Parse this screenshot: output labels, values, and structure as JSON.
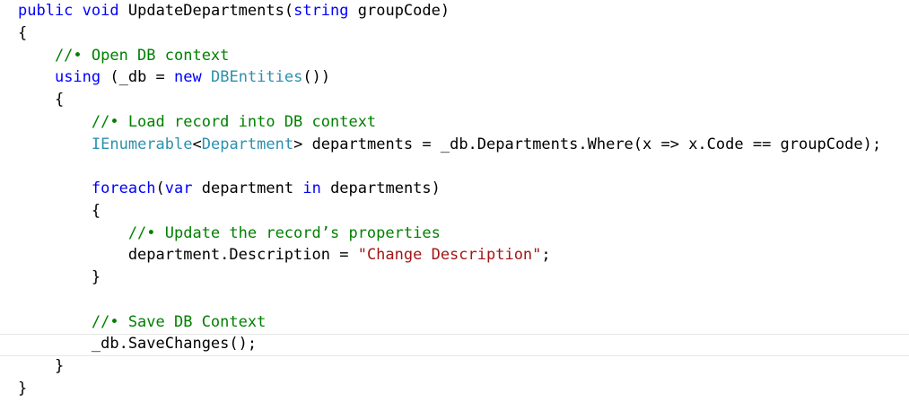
{
  "editor": {
    "colors": {
      "keyword": "#0000ff",
      "type": "#2b91af",
      "comment": "#008000",
      "string": "#a31515",
      "plain": "#000000",
      "background": "#ffffff"
    },
    "lines": [
      [
        {
          "t": "kw",
          "v": "public"
        },
        {
          "t": "pl",
          "v": " "
        },
        {
          "t": "kw",
          "v": "void"
        },
        {
          "t": "pl",
          "v": " UpdateDepartments("
        },
        {
          "t": "kw",
          "v": "string"
        },
        {
          "t": "pl",
          "v": " groupCode)"
        }
      ],
      [
        {
          "t": "pl",
          "v": "{"
        }
      ],
      [
        {
          "t": "cm",
          "v": "    //• Open DB context"
        }
      ],
      [
        {
          "t": "pl",
          "v": "    "
        },
        {
          "t": "kw",
          "v": "using"
        },
        {
          "t": "pl",
          "v": " (_db = "
        },
        {
          "t": "kw",
          "v": "new"
        },
        {
          "t": "pl",
          "v": " "
        },
        {
          "t": "ty",
          "v": "DBEntities"
        },
        {
          "t": "pl",
          "v": "())"
        }
      ],
      [
        {
          "t": "pl",
          "v": "    {"
        }
      ],
      [
        {
          "t": "cm",
          "v": "        //• Load record into DB context"
        }
      ],
      [
        {
          "t": "pl",
          "v": "        "
        },
        {
          "t": "ty",
          "v": "IEnumerable"
        },
        {
          "t": "pl",
          "v": "<"
        },
        {
          "t": "ty",
          "v": "Department"
        },
        {
          "t": "pl",
          "v": "> departments = _db.Departments.Where(x => x.Code == groupCode);"
        }
      ],
      [
        {
          "t": "pl",
          "v": ""
        }
      ],
      [
        {
          "t": "pl",
          "v": "        "
        },
        {
          "t": "kw",
          "v": "foreach"
        },
        {
          "t": "pl",
          "v": "("
        },
        {
          "t": "kw",
          "v": "var"
        },
        {
          "t": "pl",
          "v": " department "
        },
        {
          "t": "kw",
          "v": "in"
        },
        {
          "t": "pl",
          "v": " departments)"
        }
      ],
      [
        {
          "t": "pl",
          "v": "        {"
        }
      ],
      [
        {
          "t": "cm",
          "v": "            //• Update the record’s properties"
        }
      ],
      [
        {
          "t": "pl",
          "v": "            department.Description = "
        },
        {
          "t": "st",
          "v": "\"Change Description\""
        },
        {
          "t": "pl",
          "v": ";"
        }
      ],
      [
        {
          "t": "pl",
          "v": "        }"
        }
      ],
      [
        {
          "t": "pl",
          "v": ""
        }
      ],
      [
        {
          "t": "cm",
          "v": "        //• Save DB Context"
        }
      ],
      [
        {
          "t": "pl",
          "v": "        _db.SaveChanges();"
        }
      ],
      [
        {
          "t": "pl",
          "v": "    }"
        }
      ],
      [
        {
          "t": "pl",
          "v": "}"
        }
      ]
    ]
  }
}
